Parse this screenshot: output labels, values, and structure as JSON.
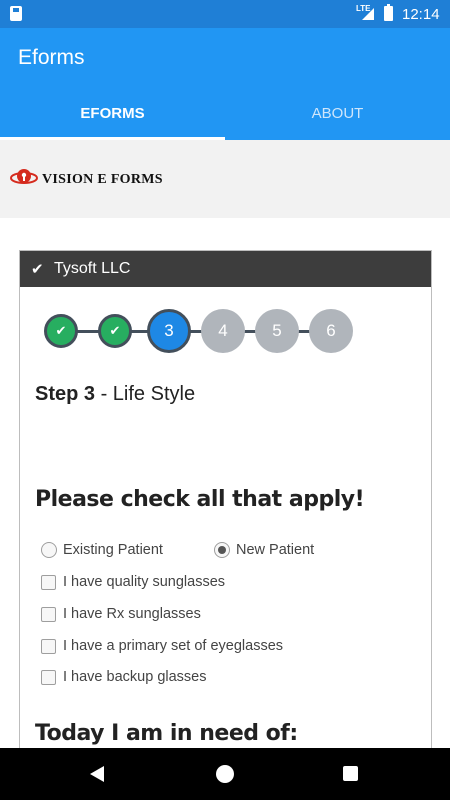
{
  "status_bar": {
    "time": "12:14",
    "network": "LTE"
  },
  "app_bar": {
    "title": "Eforms",
    "tabs": [
      {
        "label": "EFORMS",
        "selected": true
      },
      {
        "label": "ABOUT",
        "selected": false
      }
    ]
  },
  "logo": {
    "text": "VISION E FORMS"
  },
  "card": {
    "header": {
      "company": "Tysoft LLC"
    },
    "stepper": {
      "current_step": 3,
      "steps": [
        {
          "label": "",
          "state": "done"
        },
        {
          "label": "",
          "state": "done"
        },
        {
          "label": "3",
          "state": "active"
        },
        {
          "label": "4",
          "state": "todo"
        },
        {
          "label": "5",
          "state": "todo"
        },
        {
          "label": "6",
          "state": "todo"
        }
      ]
    },
    "step_title": {
      "prefix": "Step 3",
      "name": "- Life Style"
    },
    "section1": {
      "heading": "Please check all that apply!",
      "radios": [
        {
          "label": "Existing Patient",
          "checked": false
        },
        {
          "label": "New Patient",
          "checked": true
        }
      ],
      "checkboxes": [
        {
          "label": "I have quality sunglasses",
          "checked": false
        },
        {
          "label": "I have Rx sunglasses",
          "checked": false
        },
        {
          "label": "I have a primary set of eyeglasses",
          "checked": false
        },
        {
          "label": "I have backup glasses",
          "checked": false
        }
      ]
    },
    "section2": {
      "heading": "Today I am in need of:"
    }
  },
  "colors": {
    "status_bar": "#1f7fd6",
    "app_bar": "#2196f3",
    "card_header": "#3d3d3d",
    "step_done": "#27ae60",
    "step_active": "#1e88e5",
    "step_todo": "#b0b5bb"
  }
}
